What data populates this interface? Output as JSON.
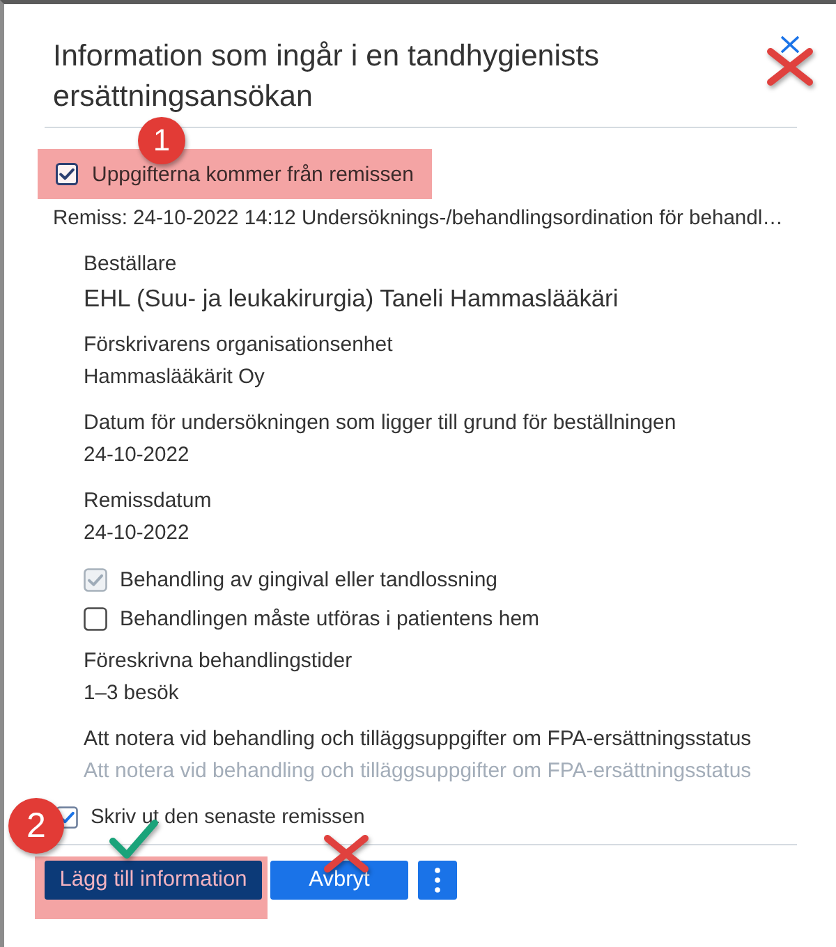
{
  "dialog": {
    "title": "Information som ingår i en tandhygienists ersättningsansökan",
    "close_annotation": {
      "kind": "cross"
    }
  },
  "source_option": {
    "label": "Uppgifterna kommer från remissen",
    "checked": true,
    "highlighted": true,
    "marker": "1"
  },
  "referral": "Remiss: 24-10-2022 14:12 Undersöknings-/behandlingsordination för behandl…",
  "details": [
    {
      "kind": "field",
      "label": "Beställare",
      "value": "EHL (Suu- ja leukakirurgia) Taneli Hammaslääkäri",
      "emphasis": true
    },
    {
      "kind": "field",
      "label": "Förskrivarens organisationsenhet",
      "value": "Hammaslääkärit Oy",
      "emphasis": false
    },
    {
      "kind": "field",
      "label": "Datum för undersökningen som ligger till grund för beställningen",
      "value": "24-10-2022",
      "emphasis": false
    },
    {
      "kind": "field",
      "label": "Remissdatum",
      "value": "24-10-2022",
      "emphasis": false
    },
    {
      "kind": "checkbox",
      "label": "Behandling av gingival eller tandlossning",
      "checked": true,
      "disabled": true
    },
    {
      "kind": "checkbox",
      "label": "Behandlingen måste utföras i patientens hem",
      "checked": false,
      "disabled": false
    },
    {
      "kind": "field",
      "label": "Föreskrivna behandlingstider",
      "value": "1–3 besök",
      "emphasis": false
    },
    {
      "kind": "input",
      "label": "Att notera vid behandling och tilläggsuppgifter om FPA-ersättningsstatus",
      "placeholder": "Att notera vid behandling och tilläggsuppgifter om FPA-ersättningsstatus"
    }
  ],
  "print_option": {
    "label": "Skriv ut den senaste remissen",
    "checked": true
  },
  "footer": {
    "marker": "2",
    "buttons": [
      {
        "kind": "primary",
        "label": "Lägg till information",
        "highlighted": true,
        "annotation": {
          "kind": "tick"
        }
      },
      {
        "kind": "secondary",
        "label": "Avbryt",
        "highlighted": false,
        "annotation": {
          "kind": "cross"
        }
      },
      {
        "kind": "more",
        "highlighted": false
      }
    ]
  }
}
